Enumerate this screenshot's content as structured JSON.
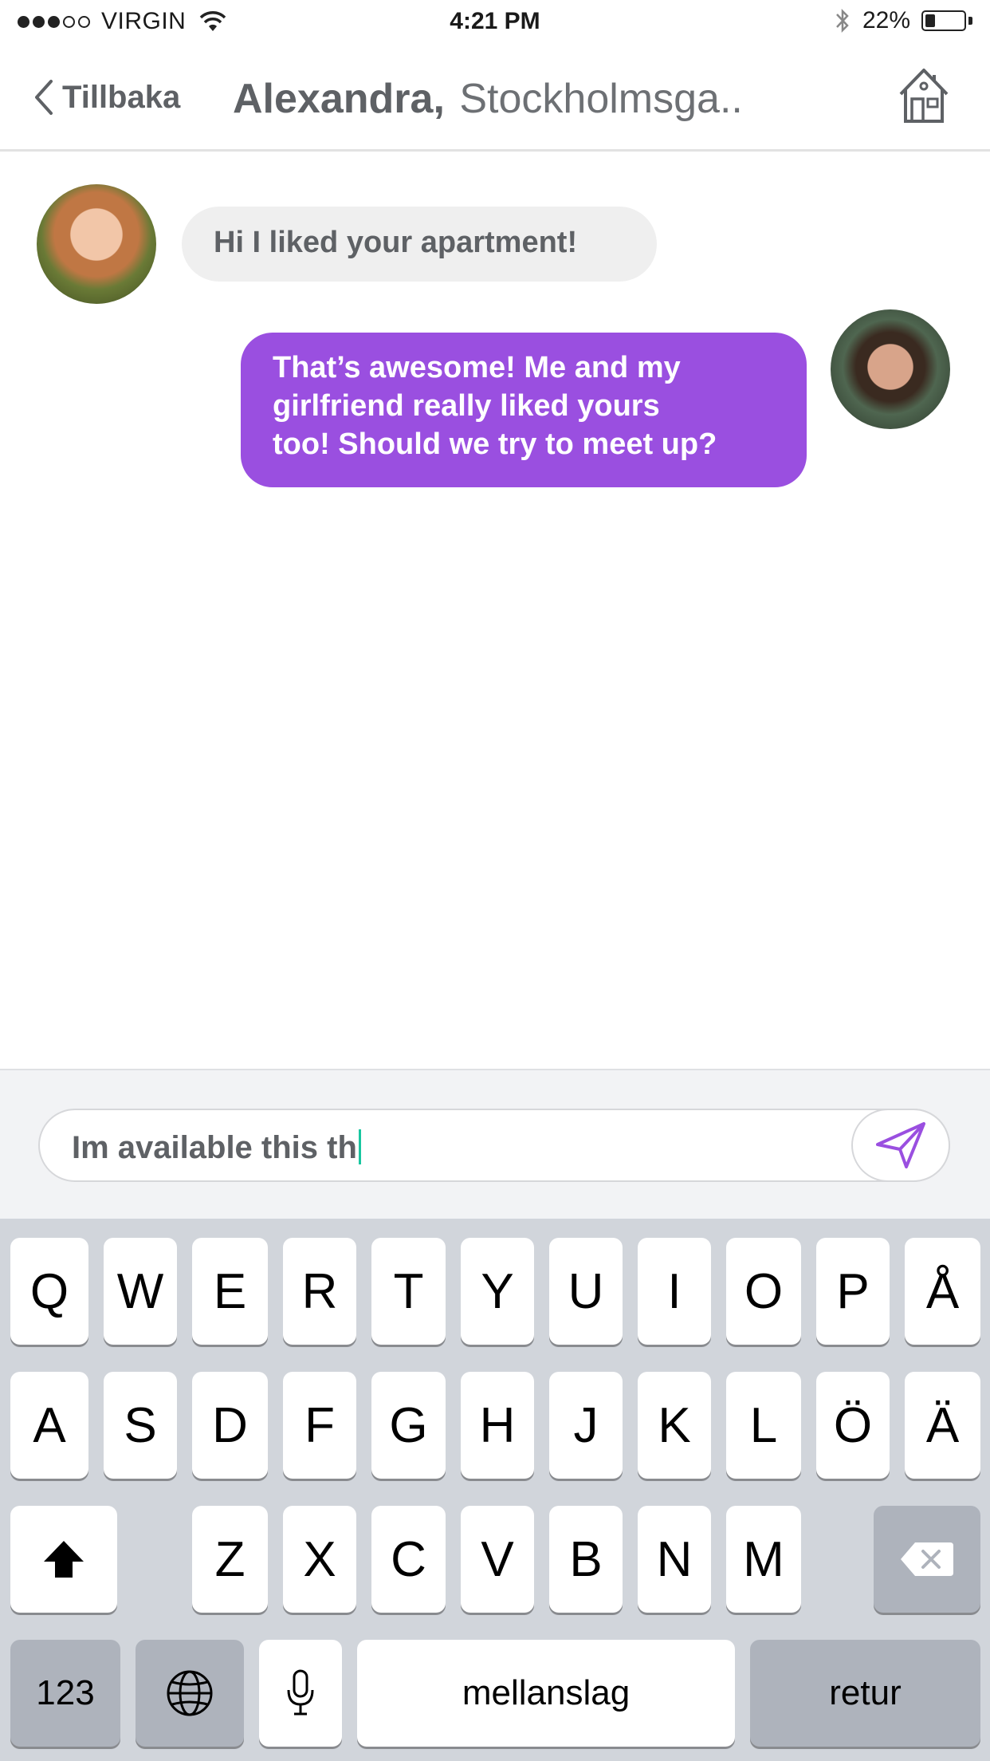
{
  "status_bar": {
    "carrier": "VIRGIN",
    "time": "4:21 PM",
    "battery": "22%",
    "battery_level": 0.22,
    "signal_bars": 3,
    "signal_total": 5
  },
  "nav": {
    "back_label": "Tillbaka",
    "contact_name": "Alexandra,",
    "address": "Stockholmsga.."
  },
  "messages": [
    {
      "from": "incoming",
      "text": "Hi I liked your apartment!"
    },
    {
      "from": "outgoing",
      "lines": [
        "That’s awesome! Me and my",
        "girlfriend really liked yours",
        "too! Should we try to meet up?"
      ]
    }
  ],
  "composer": {
    "value": "Im available this th"
  },
  "keyboard": {
    "row1": [
      "Q",
      "W",
      "E",
      "R",
      "T",
      "Y",
      "U",
      "I",
      "O",
      "P",
      "Å"
    ],
    "row2": [
      "A",
      "S",
      "D",
      "F",
      "G",
      "H",
      "J",
      "K",
      "L",
      "Ö",
      "Ä"
    ],
    "row3": [
      "Z",
      "X",
      "C",
      "V",
      "B",
      "N",
      "M"
    ],
    "numbers_label": "123",
    "space_label": "mellanslag",
    "return_label": "retur"
  },
  "colors": {
    "accent": "#9a4fe0",
    "incoming_bubble": "#efefef",
    "text_gray": "#5e6165",
    "caret": "#19c6a0",
    "keyboard_bg": "#d1d5db"
  },
  "icons": {
    "back": "chevron-left-icon",
    "home": "house-icon",
    "send": "paper-plane-icon",
    "shift": "shift-arrow-icon",
    "delete": "backspace-icon",
    "globe": "globe-icon",
    "mic": "microphone-icon"
  }
}
